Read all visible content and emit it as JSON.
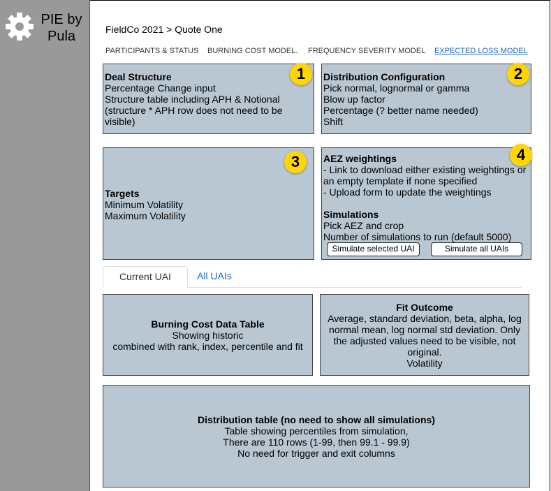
{
  "app": {
    "logo_text": "PIE by Pula"
  },
  "breadcrumb": "FieldCo 2021 > Quote One",
  "nav_tabs": [
    {
      "label": "PARTICIPANTS & STATUS"
    },
    {
      "label": "BURNING COST MODEL."
    },
    {
      "label": "FREQUENCY SEVERITY MODEL"
    },
    {
      "label": "EXPECTED LOSS MODEL"
    }
  ],
  "panels": {
    "deal_structure": {
      "badge": "1",
      "title": "Deal Structure",
      "lines": [
        "Percentage Change input",
        "Structure table including APH & Notional",
        "(structure * APH row does not need to be visible)"
      ]
    },
    "distribution_configuration": {
      "badge": "2",
      "title": "Distribution Configuration",
      "lines": [
        "Pick normal, lognormal or gamma",
        "Blow up factor",
        "Percentage (? better name needed)",
        "Shift"
      ]
    },
    "targets": {
      "badge": "3",
      "title": "Targets",
      "lines": [
        "Minimum Volatility",
        "Maximum Volatility"
      ]
    },
    "aez": {
      "badge": "4",
      "title": "AEZ weightings",
      "lines": [
        "- Link to download either existing weightings or an empty template if none specified",
        "- Upload form to update the weightings"
      ],
      "sim_title": "Simulations",
      "sim_lines": [
        "Pick AEZ and crop",
        "Number of simulations to run (default 5000)"
      ],
      "btn_selected": "Simulate selected UAI",
      "btn_all": "Simulate all UAIs"
    }
  },
  "tabs": {
    "current": "Current UAI",
    "all": "All UAIs"
  },
  "burning_cost": {
    "title": "Burning Cost Data Table",
    "lines": [
      "Showing historic",
      "combined with rank, index, percentile and fit"
    ]
  },
  "fit_outcome": {
    "title": "Fit Outcome",
    "lines": [
      "Average, standard deviation, beta, alpha, log normal mean, log normal std deviation. Only the adjusted values need to be visible, not original.",
      "Volatility"
    ]
  },
  "distribution_table": {
    "title": "Distribution table (no need to show all simulations)",
    "lines": [
      "Table showing percentiles from simulation,",
      "There are 110 rows (1-99, then 99.1 - 99.9)",
      "No need for trigger and exit columns"
    ]
  }
}
